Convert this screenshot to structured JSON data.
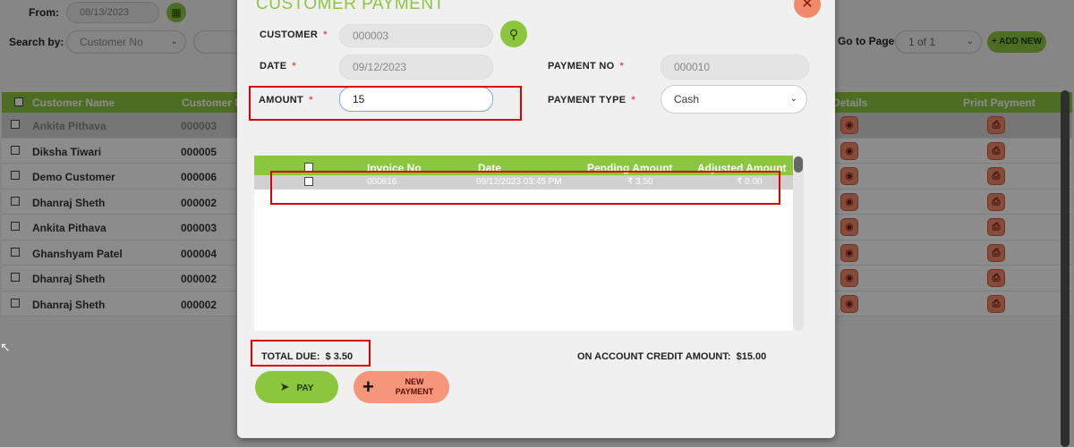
{
  "header": {
    "from_label": "From:",
    "from_value": "08/13/2023",
    "calendar_icon": "calendar-icon",
    "search_by_label": "Search by:",
    "search_by_value": "Customer No",
    "goto_label": "Go to Page",
    "goto_value": "1 of 1",
    "add_new_label": "+ ADD NEW"
  },
  "grid": {
    "columns": [
      "Customer Name",
      "Customer N",
      "Details",
      "Print Payment"
    ],
    "rows": [
      {
        "name": "Ankita Pithava",
        "no": "000003",
        "selected": true
      },
      {
        "name": "Diksha Tiwari",
        "no": "000005"
      },
      {
        "name": "Demo Customer",
        "no": "000006"
      },
      {
        "name": "Dhanraj Sheth",
        "no": "000002"
      },
      {
        "name": "Ankita Pithava",
        "no": "000003"
      },
      {
        "name": "Ghanshyam Patel",
        "no": "000004"
      },
      {
        "name": "Dhanraj Sheth",
        "no": "000002"
      },
      {
        "name": "Dhanraj Sheth",
        "no": "000002"
      }
    ]
  },
  "modal": {
    "title": "CUSTOMER PAYMENT",
    "close_icon": "close-icon",
    "customer_label": "CUSTOMER",
    "customer_value": "000003",
    "date_label": "DATE",
    "date_value": "09/12/2023",
    "amount_label": "AMOUNT",
    "amount_value": "15",
    "payment_no_label": "PAYMENT NO",
    "payment_no_value": "000010",
    "payment_type_label": "PAYMENT TYPE",
    "payment_type_value": "Cash",
    "required_mark": "*",
    "invoice_table": {
      "columns": [
        "Invoice No",
        "Date",
        "Pending Amount",
        "Adjusted Amount"
      ],
      "rows": [
        {
          "invoice_no": "000816",
          "date": "09/12/2023 03:45 PM",
          "pending": "₹ 3.50",
          "adjusted": "₹ 0.00"
        }
      ]
    },
    "total_due_label": "TOTAL DUE:",
    "total_due_value": "$ 3.50",
    "credit_label": "ON ACCOUNT CREDIT AMOUNT:",
    "credit_value": "$15.00",
    "pay_label": "PAY",
    "new_payment_label_1": "NEW",
    "new_payment_label_2": "PAYMENT"
  },
  "colors": {
    "accent_green": "#8cc63f",
    "accent_salmon": "#f08a6a",
    "highlight_red": "#e00000"
  }
}
